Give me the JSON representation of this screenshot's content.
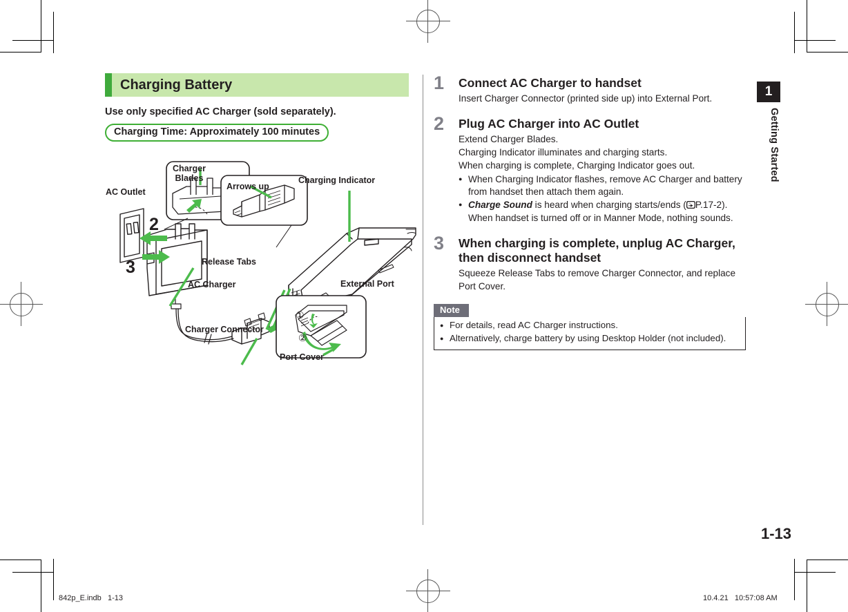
{
  "chapter": {
    "number": "1",
    "label": "Getting Started"
  },
  "section": {
    "title": "Charging Battery",
    "lead": "Use only specified AC Charger (sold separately).",
    "pill": "Charging Time: Approximately 100 minutes",
    "accent_green": "#3faa3c",
    "head_bg": "#c8e7ac",
    "pill_border": "#3faf35"
  },
  "illustration": {
    "labels": {
      "ac_outlet": "AC Outlet",
      "charger_blades": "Charger\nBlades",
      "arrows_up": "Arrows up",
      "charging_indicator": "Charging Indicator",
      "release_tabs": "Release Tabs",
      "ac_charger": "AC Charger",
      "charger_connector": "Charger Connector",
      "external_port": "External Port",
      "port_cover": "Port Cover"
    },
    "callout_numbers": [
      "1",
      "2",
      "3"
    ],
    "port_cover_steps": [
      "①",
      "②"
    ],
    "arrow_color": "#4cbb4c",
    "line_color": "#231f20"
  },
  "steps": [
    {
      "num": "1",
      "head": "Connect AC Charger to handset",
      "lines": [
        "Insert Charger Connector (printed side up) into External Port."
      ],
      "bullets": []
    },
    {
      "num": "2",
      "head": "Plug AC Charger into AC Outlet",
      "lines": [
        "Extend Charger Blades.",
        "Charging Indicator illuminates and charging starts.",
        "When charging is complete, Charging Indicator goes out."
      ],
      "bullets": [
        {
          "plain": "When Charging Indicator flashes, remove AC Charger and battery from handset then attach them again."
        },
        {
          "emphasis": "Charge Sound",
          "after_emphasis": " is heard when charging starts/ends (",
          "ref_icon": "pointing-hand-icon",
          "ref": "P.17-2).",
          "second_line": "When handset is turned off or in Manner Mode, nothing sounds."
        }
      ]
    },
    {
      "num": "3",
      "head": "When charging is complete, unplug AC Charger, then disconnect handset",
      "lines": [
        "Squeeze Release Tabs to remove Charger Connector, and replace Port Cover."
      ],
      "bullets": []
    }
  ],
  "note": {
    "label": "Note",
    "items": [
      "For details, read AC Charger instructions.",
      "Alternatively, charge battery by using Desktop Holder (not included)."
    ],
    "tab_bg": "#6e6e78"
  },
  "folio": "1-13",
  "footer": {
    "left": "842p_E.indb   1-13",
    "right": "10.4.21   10:57:08 AM"
  }
}
